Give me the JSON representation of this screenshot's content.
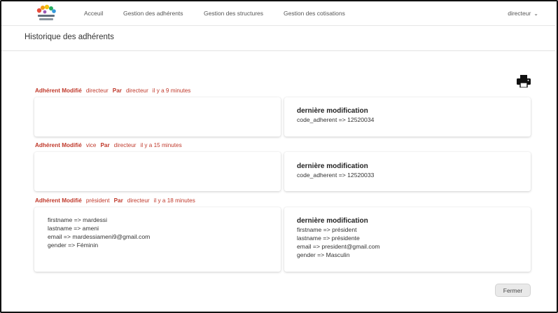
{
  "nav": {
    "links": [
      "Acceuil",
      "Gestion des adhérents",
      "Gestion des structures",
      "Gestion des cotisations"
    ],
    "user": "directeur",
    "chevron_icon": "chevron-down-icon"
  },
  "page": {
    "title": "Historique des adhérents"
  },
  "toolbar": {
    "print_icon": "printer-icon"
  },
  "entries": [
    {
      "action": "Adhérent Modifié",
      "actor": "directeur",
      "by_label": "Par",
      "by": "directeur",
      "time": "il y a 9 minutes",
      "before": [],
      "after_title": "dernière modification",
      "after": [
        "code_adherent => 12520034"
      ]
    },
    {
      "action": "Adhérent Modifié",
      "actor": "vice",
      "by_label": "Par",
      "by": "directeur",
      "time": "il y a 15 minutes",
      "before": [],
      "after_title": "dernière modification",
      "after": [
        "code_adherent => 12520033"
      ]
    },
    {
      "action": "Adhérent Modifié",
      "actor": "président",
      "by_label": "Par",
      "by": "directeur",
      "time": "il y a 18 minutes",
      "before": [
        "firstname => mardessi",
        "lastname => ameni",
        "email => mardessiameni9@gmail.com",
        "gender => Féminin"
      ],
      "after_title": "dernière modification",
      "after": [
        "firstname => président",
        "lastname => présidente",
        "email => president@gmail.com",
        "gender => Masculin"
      ]
    }
  ],
  "footer": {
    "close_label": "Fermer"
  },
  "colors": {
    "accent_red": "#c0392b",
    "text": "#333333",
    "border": "#e6e6e6"
  }
}
